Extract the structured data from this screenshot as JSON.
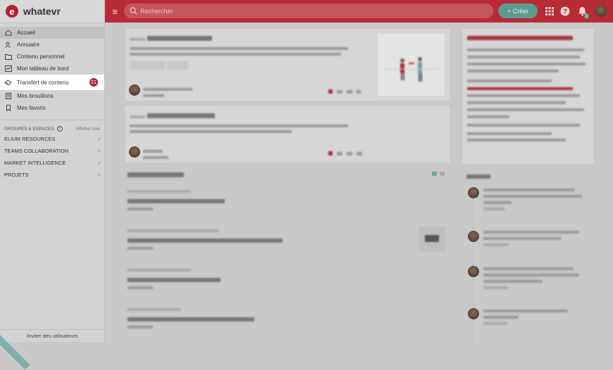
{
  "brand": {
    "logo_letter": "e",
    "name": "whatevr"
  },
  "topbar": {
    "search_placeholder": "Rechercher",
    "create_label": "+ Créer",
    "notifications_count": "1"
  },
  "sidebar": {
    "items": [
      {
        "label": "Accueil",
        "icon": "home-icon"
      },
      {
        "label": "Annuaire",
        "icon": "people-icon"
      },
      {
        "label": "Contenu personnel",
        "icon": "folder-icon"
      },
      {
        "label": "Mon tableau de bord",
        "icon": "dashboard-icon"
      },
      {
        "label": "Transfert de contenu",
        "icon": "transfer-icon",
        "badge": "21"
      },
      {
        "label": "Mes brouillons",
        "icon": "draft-icon"
      },
      {
        "label": "Mes favoris",
        "icon": "bookmark-icon"
      }
    ],
    "groups_title": "GROUPES & ESPACES",
    "groups_show_all": "Afficher tout",
    "groups": [
      "ELIUM RESOURCES",
      "TEAMS COLLABORATION",
      "MARKET INTELLIGENCE",
      "PROJETS"
    ],
    "invite": "Inviter des utilisateurs"
  },
  "colors": {
    "brand_red": "#b82a36",
    "create_green": "#5d9b8e"
  }
}
